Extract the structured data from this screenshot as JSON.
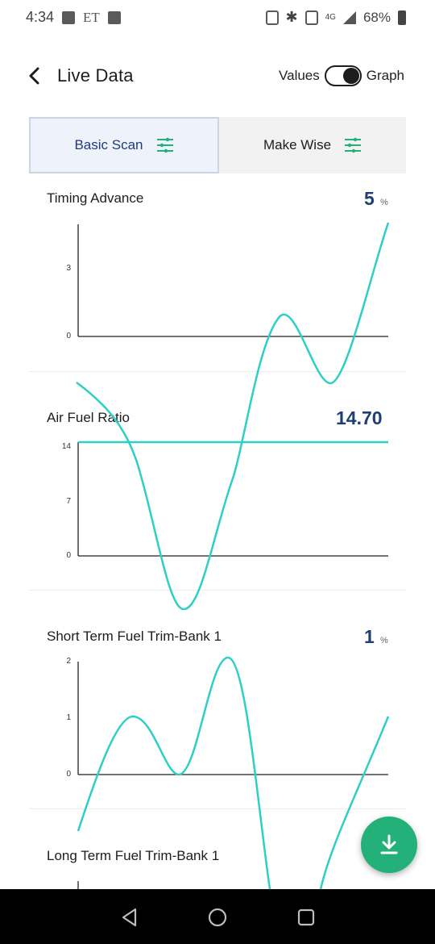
{
  "status_bar": {
    "time": "4:34",
    "carrier_text": "ET",
    "network": "4G",
    "battery": "68%"
  },
  "header": {
    "title": "Live Data",
    "toggle_left_label": "Values",
    "toggle_right_label": "Graph",
    "toggle_state": "Graph"
  },
  "tabs": [
    {
      "label": "Basic Scan",
      "active": true
    },
    {
      "label": "Make Wise",
      "active": false
    }
  ],
  "colors": {
    "accent": "#2ecfc4",
    "value_text": "#1d3f73",
    "fab": "#23b079"
  },
  "panels": [
    {
      "title": "Timing Advance",
      "value": "5",
      "unit": "%"
    },
    {
      "title": "Air Fuel Ratio",
      "value": "14.70",
      "unit": ""
    },
    {
      "title": "Short Term Fuel Trim-Bank 1",
      "value": "1",
      "unit": "%"
    },
    {
      "title": "Long Term Fuel Trim-Bank 1",
      "value": "",
      "unit": ""
    }
  ],
  "chart_data": [
    {
      "type": "line",
      "title": "Timing Advance",
      "yticks": [
        "3",
        "0"
      ],
      "ylim": [
        0,
        5
      ],
      "values": [
        5
      ]
    },
    {
      "type": "line",
      "title": "Air Fuel Ratio",
      "yticks": [
        "14",
        "7",
        "0"
      ],
      "ylim": [
        0,
        14
      ],
      "values": [
        14.7
      ]
    },
    {
      "type": "line",
      "title": "Short Term Fuel Trim-Bank 1",
      "yticks": [
        "2",
        "1",
        "0"
      ],
      "ylim": [
        0,
        2
      ],
      "values": [
        1
      ]
    }
  ],
  "icons": {
    "back": "chevron-left-icon",
    "filter": "sliders-icon",
    "fab": "download-icon",
    "nav_back": "triangle-back-icon",
    "nav_home": "circle-home-icon",
    "nav_recents": "square-recents-icon"
  }
}
